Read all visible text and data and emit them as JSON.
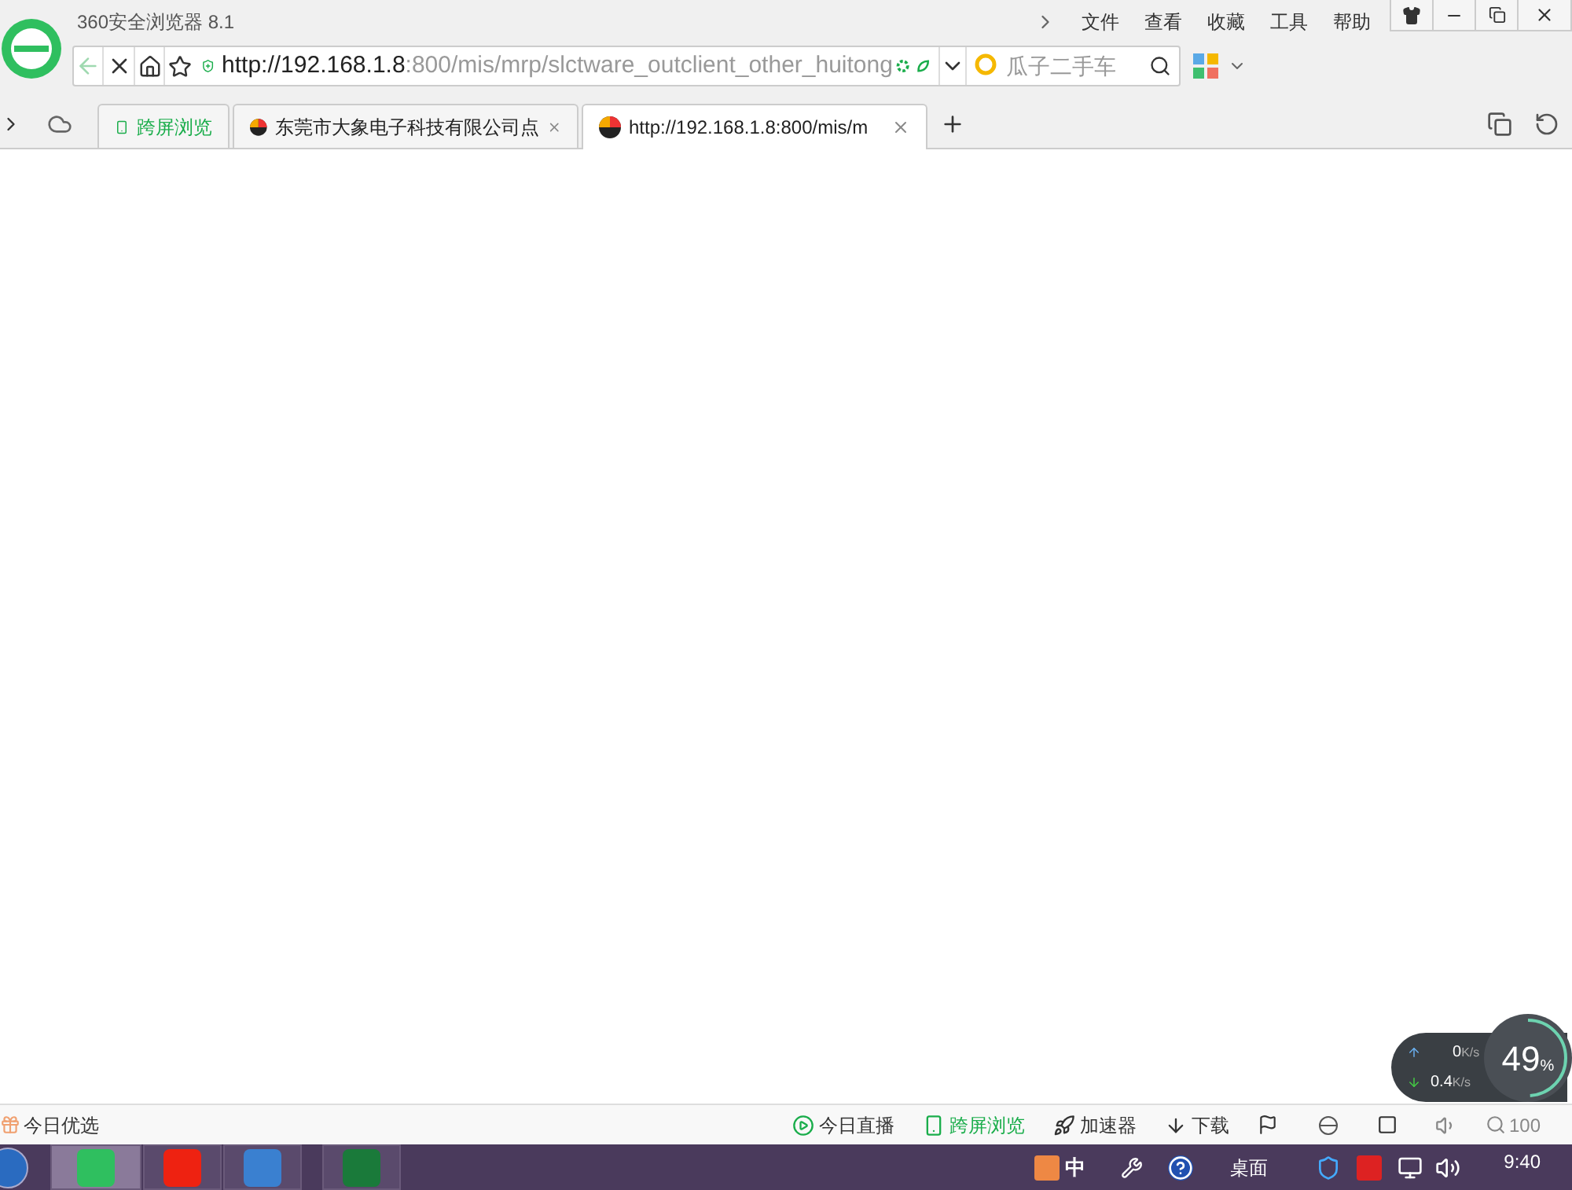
{
  "window": {
    "title": "360安全浏览器 8.1"
  },
  "menu": [
    "文件",
    "查看",
    "收藏",
    "工具",
    "帮助"
  ],
  "address": {
    "host": "http://192.168.1.8",
    "rest": ":800/mis/mrp/slctware_outclient_other_huitong"
  },
  "search": {
    "placeholder": "瓜子二手车"
  },
  "tabs": [
    {
      "label": "跨屏浏览",
      "kind": "special",
      "selected": false
    },
    {
      "label": "东莞市大象电子科技有限公司点",
      "kind": "page",
      "selected": false
    },
    {
      "label": "http://192.168.1.8:800/mis/m",
      "kind": "page",
      "selected": true
    }
  ],
  "status_bar": {
    "left": "今日优选",
    "items": [
      {
        "label": "今日直播",
        "kind": "play"
      },
      {
        "label": "跨屏浏览",
        "kind": "phone"
      },
      {
        "label": "加速器",
        "kind": "rocket"
      },
      {
        "label": "下载",
        "kind": "download"
      }
    ],
    "zoom": "100"
  },
  "network": {
    "up": "0",
    "down": "0.4",
    "up_unit": "K/s",
    "down_unit": "K/s",
    "percent": "49",
    "unit_percent": "%",
    "level": 0.49
  },
  "taskbar": {
    "ime": "中",
    "desktop": "桌面",
    "time": "9:40"
  }
}
